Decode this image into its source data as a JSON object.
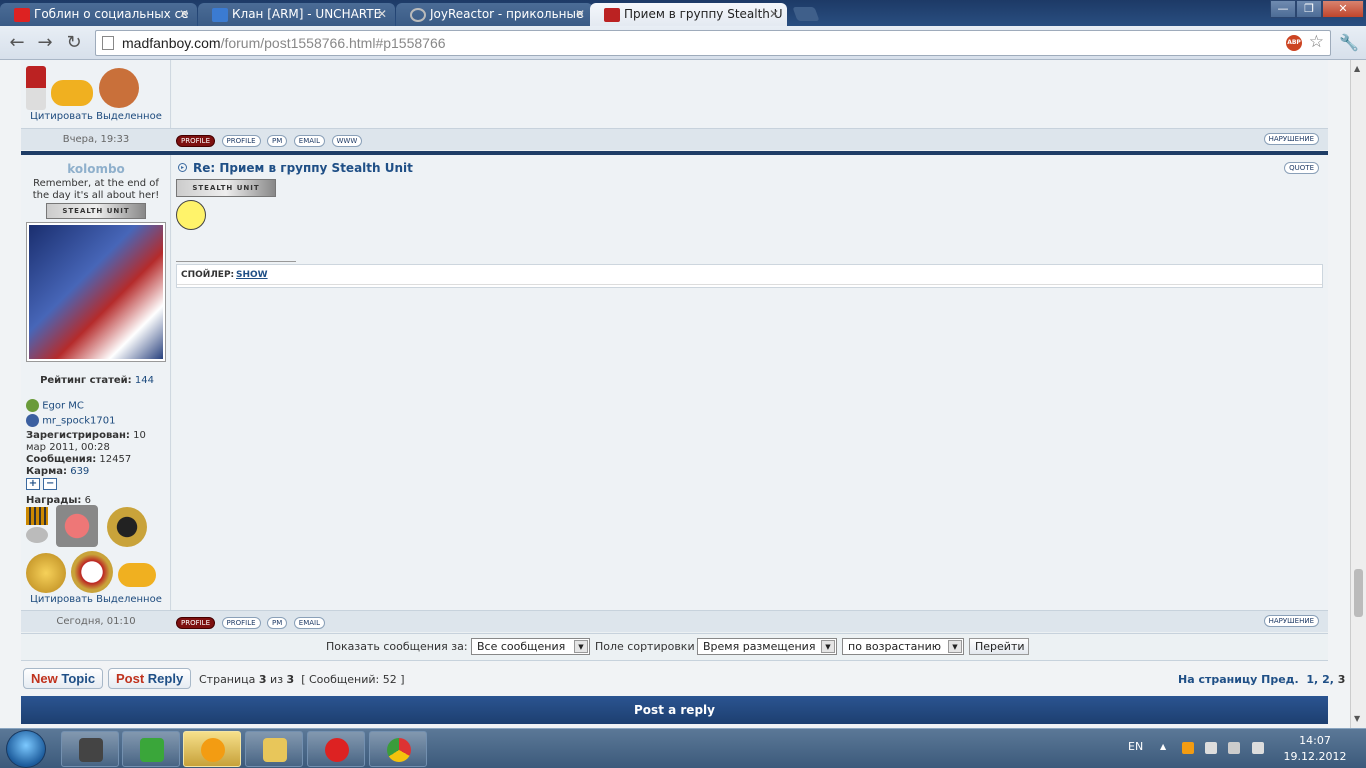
{
  "browser": {
    "tabs": [
      {
        "title": "Гоблин о социальных се",
        "icon_color": "#d22"
      },
      {
        "title": "Клан [ARM] - UNCHARTE",
        "icon_color": "#3b7bd1"
      },
      {
        "title": "JoyReactor - прикольные",
        "icon_color": "#999"
      },
      {
        "title": "Прием в группу Stealth U",
        "icon_color": "#b22",
        "active": true
      }
    ],
    "url_host": "madfanboy.com",
    "url_rest": "/forum/post1558766.html#p1558766",
    "abp_label": "ABP",
    "window_buttons": [
      "—",
      "❐",
      "✕"
    ]
  },
  "post_prev": {
    "cite_label": "Цитировать Выделенное",
    "date": "Вчера, 19:33",
    "buttons": [
      "PROFILE",
      "PROFILE",
      "PM",
      "EMAIL",
      "WWW"
    ],
    "violation": "НАРУШЕНИЕ"
  },
  "post": {
    "author": "kolombo",
    "motto": "Remember, at the end of the day it's all about her!",
    "badge_text": "STEALTH UNIT",
    "rating_label": "Рейтинг статей:",
    "rating_value": "144",
    "contacts": [
      {
        "icon": "xbox-icon",
        "name": "Egor MC",
        "color": "#6a9b3a"
      },
      {
        "icon": "psn-icon",
        "name": "mr_spock1701",
        "color": "#3b5fa0"
      }
    ],
    "registered_label": "Зарегистрирован:",
    "registered_value": "10 мар 2011, 00:28",
    "messages_label": "Сообщения:",
    "messages_value": "12457",
    "karma_label": "Карма:",
    "karma_value": "639",
    "karma_plus": "+",
    "karma_minus": "−",
    "awards_label": "Награды:",
    "awards_value": "6",
    "cite_label": "Цитировать Выделенное",
    "title": "Re: Прием в группу Stealth Unit",
    "quote_btn": "QUOTE",
    "spoiler_label": "СПОЙЛЕР:",
    "spoiler_link": "SHOW",
    "date": "Сегодня, 01:10",
    "buttons": [
      "PROFILE",
      "PROFILE",
      "PM",
      "EMAIL"
    ],
    "violation": "НАРУШЕНИЕ"
  },
  "filter": {
    "show_label": "Показать сообщения за:",
    "show_value": "Все сообщения",
    "sort_label": "Поле сортировки",
    "sort_value": "Время размещения",
    "order_value": "по возрастанию",
    "go_label": "Перейти"
  },
  "pagination": {
    "new_topic_1": "New",
    "new_topic_2": "Topic",
    "post_reply_1": "Post",
    "post_reply_2": "Reply",
    "page_prefix": "Страница",
    "page_current": "3",
    "page_of": "из",
    "page_total": "3",
    "messages_text": "[ Сообщений: 52 ]",
    "nav_label": "На страницу Пред.",
    "pages": [
      "1",
      "2",
      "3"
    ]
  },
  "post_reply_bar": "Post a reply",
  "taskbar": {
    "lang": "EN",
    "time": "14:07",
    "date": "19.12.2012"
  }
}
